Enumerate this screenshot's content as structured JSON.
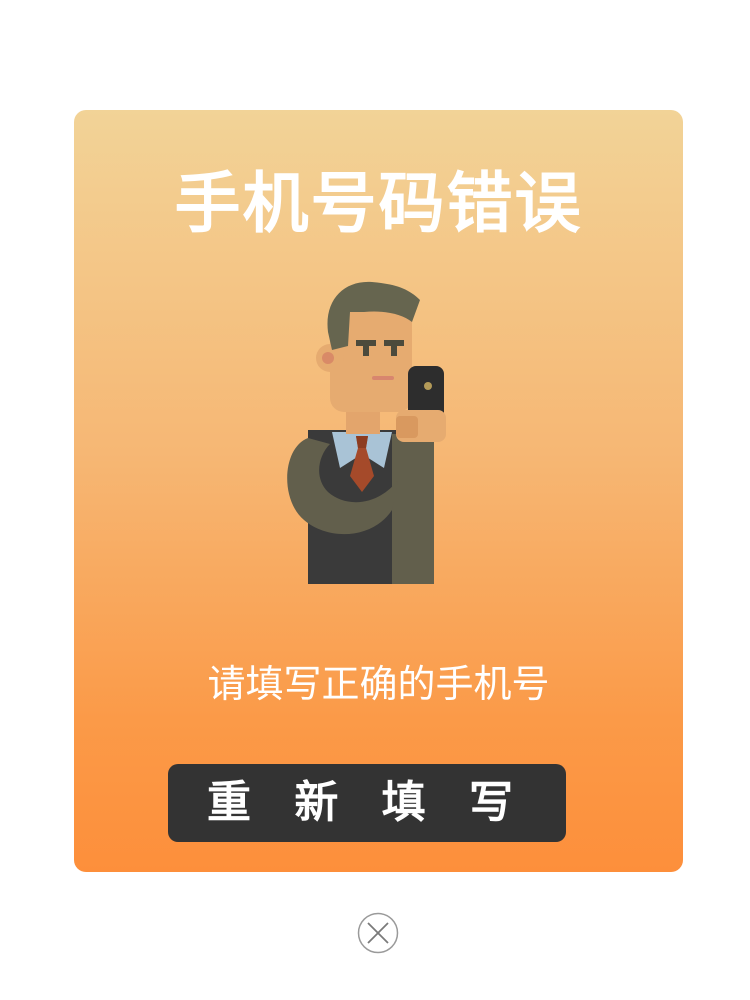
{
  "dialog": {
    "title": "手机号码错误",
    "message": "请填写正确的手机号",
    "retry_label": "重 新 填 写"
  },
  "icons": {
    "illustration": "man-holding-phone-illustration",
    "close": "close-icon"
  },
  "colors": {
    "gradient_top": "#f2d397",
    "gradient_bottom": "#fd8f3b",
    "button_bg": "#333333",
    "text": "#ffffff"
  }
}
